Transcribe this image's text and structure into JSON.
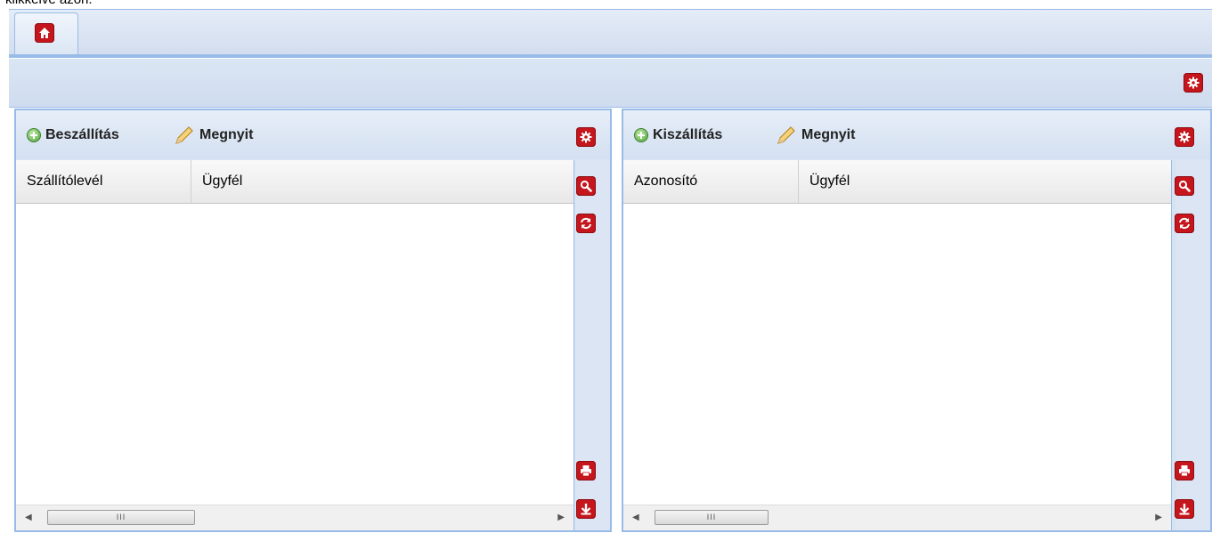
{
  "top_text": "klikkelve azon.",
  "tabs": {
    "home_tab_icon": "home-icon"
  },
  "toolbar": {
    "settings_icon": "gear-icon"
  },
  "left_panel": {
    "add_label": "Beszállítás",
    "open_label": "Megnyit",
    "columns": [
      "Szállítólevél",
      "Ügyfél"
    ],
    "scroll_thumb": "III"
  },
  "right_panel": {
    "add_label": "Kiszállítás",
    "open_label": "Megnyit",
    "columns": [
      "Azonosító",
      "Ügyfél"
    ],
    "scroll_thumb": "III"
  },
  "colors": {
    "accent_red": "#c4161c",
    "border_blue": "#99bbe8"
  }
}
